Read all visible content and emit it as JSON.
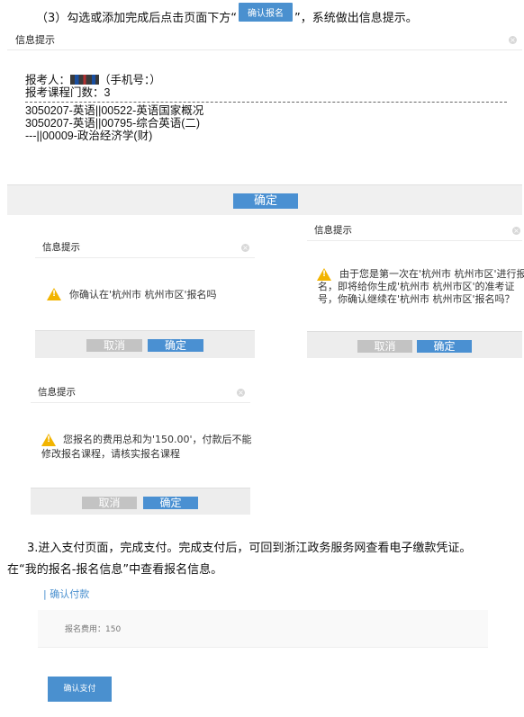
{
  "step3": {
    "prefix": "（3）勾选或添加完成后点击页面下方“",
    "button": "确认报名",
    "suffix": "”，系统做出信息提示。"
  },
  "dialog_main": {
    "title": "信息提示",
    "applicant_label": "报考人：",
    "applicant_phone": "（手机号：）",
    "course_count": "报考课程门数：3",
    "courses": [
      "3050207-英语||00522-英语国家概况",
      "3050207-英语||00795-综合英语(二)",
      "---||00009-政治经济学(财)"
    ],
    "confirm": "确定"
  },
  "dialog_city": {
    "title": "信息提示",
    "message": "你确认在'杭州市 杭州市区'报名吗",
    "cancel": "取消",
    "confirm": "确定"
  },
  "dialog_first": {
    "title": "信息提示",
    "lines": [
      "由于您是第一次在'杭州市 杭州市区'进行报",
      "名，即将给你生成'杭州市 杭州市区'的准考证",
      "号，你确认继续在'杭州市 杭州市区'报名吗？"
    ],
    "cancel": "取消",
    "confirm": "确定"
  },
  "dialog_fee": {
    "title": "信息提示",
    "lines": [
      "您报名的费用总和为'150.00'，付款后不能",
      "修改报名课程，请核实报名课程"
    ],
    "cancel": "取消",
    "confirm": "确定"
  },
  "para3": {
    "line1": "3.进入支付页面，完成支付。完成支付后，可回到浙江政务服务网查看电子缴款凭证。",
    "line2": "在“我的报名-报名信息”中查看报名信息。"
  },
  "payment": {
    "title": "| 确认付款",
    "fee": "报名费用：150",
    "button": "确认支付"
  },
  "colors": {
    "primary_button": "#4a90cf",
    "warning": "#f2b400",
    "cancel_button": "#c3c3c3"
  }
}
